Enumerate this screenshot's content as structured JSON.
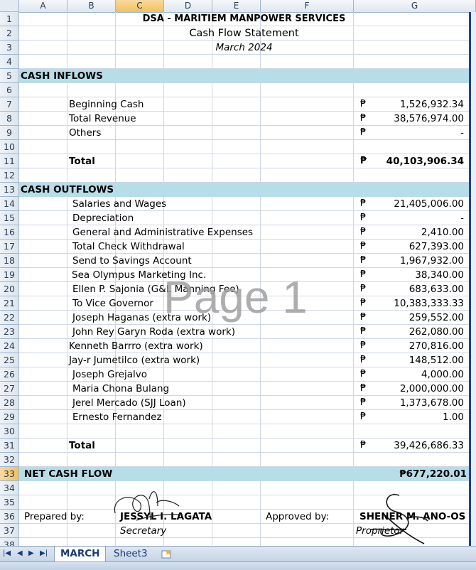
{
  "columns": [
    "A",
    "B",
    "C",
    "D",
    "E",
    "F",
    "G"
  ],
  "rows": [
    "1",
    "2",
    "3",
    "4",
    "5",
    "6",
    "7",
    "8",
    "9",
    "10",
    "11",
    "12",
    "13",
    "14",
    "15",
    "16",
    "17",
    "18",
    "19",
    "20",
    "21",
    "22",
    "23",
    "24",
    "25",
    "26",
    "27",
    "28",
    "29",
    "30",
    "31",
    "32",
    "33",
    "34",
    "35",
    "36",
    "37",
    "38"
  ],
  "selected_column": "C",
  "selected_row": "33",
  "header": {
    "company": "DSA - MARITIEM MANPOWER SERVICES",
    "title": "Cash Flow Statement",
    "period": "March 2024"
  },
  "currency_symbol": "₱",
  "inflows": {
    "section_label": "CASH INFLOWS",
    "items": [
      {
        "label": "Beginning Cash",
        "amount": "1,526,932.34"
      },
      {
        "label": "Total Revenue",
        "amount": "38,576,974.00"
      },
      {
        "label": "Others",
        "amount": "-"
      }
    ],
    "total_label": "Total",
    "total_amount": "40,103,906.34"
  },
  "outflows": {
    "section_label": "CASH OUTFLOWS",
    "items": [
      {
        "label": "Salaries and Wages",
        "amount": "21,405,006.00"
      },
      {
        "label": "Depreciation",
        "amount": "-"
      },
      {
        "label": "General and Administrative Expenses",
        "amount": "2,410.00"
      },
      {
        "label": "Total Check Withdrawal",
        "amount": "627,393.00"
      },
      {
        "label": "Send to Savings Account",
        "amount": "1,967,932.00"
      },
      {
        "label": "Sea Olympus Marketing Inc.",
        "amount": "38,340.00"
      },
      {
        "label": "Ellen P. Sajonia (G&L Manning Fee)",
        "amount": "683,633.00"
      },
      {
        "label": "To Vice Governor",
        "amount": "10,383,333.33"
      },
      {
        "label": "Joseph Haganas (extra work)",
        "amount": "259,552.00"
      },
      {
        "label": "John Rey Garyn Roda (extra work)",
        "amount": "262,080.00"
      },
      {
        "label": "Kenneth Barrro (extra work)",
        "amount": "270,816.00"
      },
      {
        "label": "Jay-r Jumetilco (extra work)",
        "amount": "148,512.00"
      },
      {
        "label": "Joseph Grejalvo",
        "amount": "4,000.00"
      },
      {
        "label": "Maria Chona Bulang",
        "amount": "2,000,000.00"
      },
      {
        "label": "Jerel Mercado (SJJ Loan)",
        "amount": "1,373,678.00"
      },
      {
        "label": "Ernesto Fernandez",
        "amount": "1.00"
      }
    ],
    "total_label": "Total",
    "total_amount": "39,426,686.33"
  },
  "net": {
    "label": "NET CASH FLOW",
    "amount": "₱677,220.01"
  },
  "signatures": {
    "prepared_label": "Prepared by:",
    "prepared_name": "JESSYL I. LAGATA",
    "prepared_role": "Secretary",
    "approved_label": "Approved by:",
    "approved_name": "SHENER M. ANO-OS",
    "approved_role": "Proprietor"
  },
  "watermark": "Page 1",
  "sheet_tabs": [
    {
      "label": "MARCH",
      "active": true
    },
    {
      "label": "Sheet3",
      "active": false
    }
  ],
  "colors": {
    "section_band": "#b7dde8",
    "selection": "#f1c15f",
    "tab_text": "#1b3a74"
  }
}
